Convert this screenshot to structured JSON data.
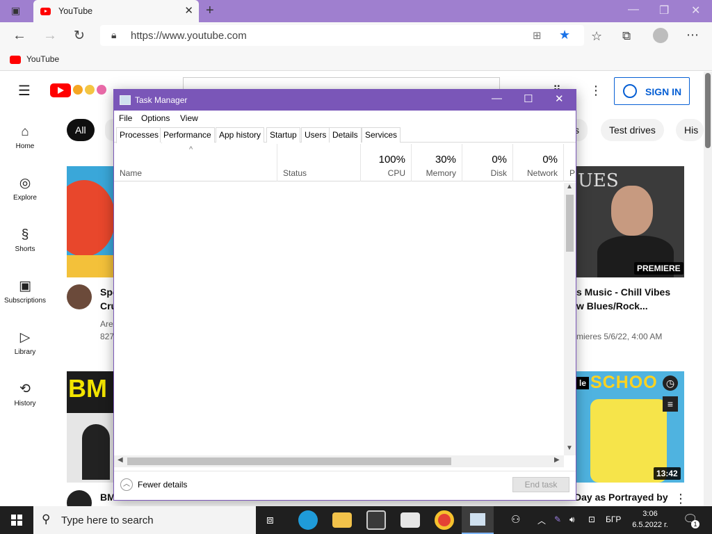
{
  "browser": {
    "tab_title": "YouTube",
    "url": "https://www.youtube.com",
    "favorite_label": "YouTube"
  },
  "youtube": {
    "signin_label": "SIGN IN",
    "sidebar": [
      {
        "label": "Home",
        "icon": "home-icon",
        "glyph": "⌂"
      },
      {
        "label": "Explore",
        "icon": "compass-icon",
        "glyph": "◎"
      },
      {
        "label": "Shorts",
        "icon": "shorts-icon",
        "glyph": "§"
      },
      {
        "label": "Subscriptions",
        "icon": "subscriptions-icon",
        "glyph": "▣"
      },
      {
        "label": "Library",
        "icon": "library-icon",
        "glyph": "▷"
      },
      {
        "label": "History",
        "icon": "history-icon",
        "glyph": "⟲"
      }
    ],
    "chips": {
      "all": "All",
      "c2": "s",
      "c3": "Test drives",
      "c4": "His"
    },
    "videos": {
      "v1": {
        "title_l1": "Spo",
        "title_l2": "Cru",
        "meta_l1": "Are",
        "meta_l2": "827"
      },
      "v2": {
        "title_l1": "s Music - Chill Vibes",
        "title_l2": "w Blues/Rock...",
        "meta_l1": "mieres 5/6/22, 4:00 AM",
        "badge": "PREMIERE",
        "thumb_text": "UES"
      },
      "v3": {
        "thumb_text": "BM",
        "title": "BM"
      },
      "v4": {
        "thumb_text": "SCHOO",
        "badge": "13:42",
        "label_partial": "le",
        "title": "Day as Portrayed by"
      }
    }
  },
  "task_manager": {
    "title": "Task Manager",
    "menu": [
      "File",
      "Options",
      "View"
    ],
    "tabs": [
      "Processes",
      "Performance",
      "App history",
      "Startup",
      "Users",
      "Details",
      "Services"
    ],
    "columns": {
      "name": "Name",
      "status": "Status",
      "cpu_pct": "100%",
      "cpu": "CPU",
      "memory_pct": "30%",
      "memory": "Memory",
      "disk_pct": "0%",
      "disk": "Disk",
      "network_pct": "0%",
      "network": "Network",
      "power": "P"
    },
    "fewer_details": "Fewer details",
    "end_task": "End task"
  },
  "taskbar": {
    "search_placeholder": "Type here to search",
    "language": "БГР",
    "time": "3:06",
    "date": "6.5.2022 г.",
    "notification_count": "1"
  }
}
